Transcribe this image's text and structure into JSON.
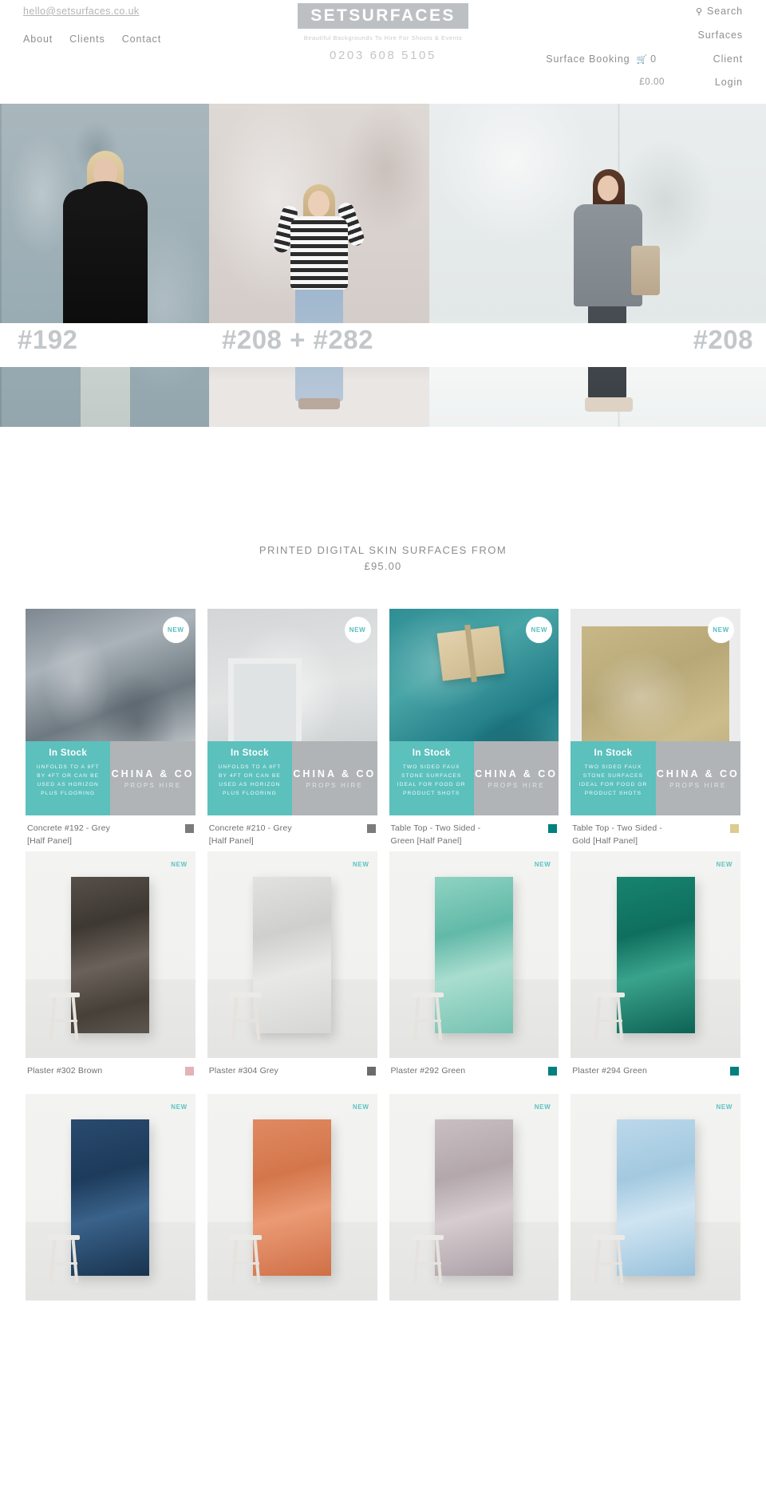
{
  "header": {
    "email": "hello@setsurfaces.co.uk",
    "nav_left": [
      {
        "label": "About"
      },
      {
        "label": "Clients"
      },
      {
        "label": "Contact"
      }
    ],
    "logo": {
      "brand": "SETSURFACES",
      "tagline": "Beautiful Backgrounds To Hire For Shoots & Events",
      "phone": "0203 608 5105",
      "box_color": "#bcc0c2"
    },
    "nav_right": {
      "search_label": "Search",
      "search_icon": "search-icon",
      "surfaces_label": "Surfaces",
      "booking_label": "Surface Booking",
      "cart_icon": "shopping-cart-icon",
      "cart_count": "0",
      "client_label": "Client",
      "cart_total": "£0.00",
      "login_label": "Login"
    }
  },
  "hero": {
    "captions": [
      {
        "text": "#192"
      },
      {
        "text": "#208 + #282"
      },
      {
        "text": "#208"
      }
    ]
  },
  "section": {
    "title": "PRINTED DIGITAL SKIN SURFACES FROM",
    "amount": "£95.00"
  },
  "overlay_defaults": {
    "stock_label": "In Stock",
    "brand_line1": "CHINA & CO",
    "brand_line2": "PROPS HIRE",
    "new_badge": "NEW",
    "teal": "#5cc0bd",
    "grey": "#b0b4b6"
  },
  "products": [
    {
      "name": "Concrete #192 - Grey [Half Panel]",
      "swatch": "#7b7b7b",
      "badge": "NEW",
      "badge_style": "circle",
      "overlay": true,
      "stock_label": "In Stock",
      "overlay_desc": "UNFOLDS TO A 8FT BY 4FT OR CAN BE USED AS HORIZON PLUS FLOORING",
      "brand_line1": "CHINA & CO",
      "brand_line2": "PROPS HIRE",
      "art": "a-concrete192"
    },
    {
      "name": "Concrete #210 - Grey [Half Panel]",
      "swatch": "#7b7b7b",
      "badge": "NEW",
      "badge_style": "circle",
      "overlay": true,
      "stock_label": "In Stock",
      "overlay_desc": "UNFOLDS TO A 8FT BY 4FT OR CAN BE USED AS HORIZON PLUS FLOORING",
      "brand_line1": "CHINA & CO",
      "brand_line2": "PROPS HIRE",
      "art": "a-concrete210"
    },
    {
      "name": "Table Top - Two Sided - Green [Half Panel]",
      "swatch": "#00807e",
      "badge": "NEW",
      "badge_style": "circle",
      "overlay": true,
      "stock_label": "In Stock",
      "overlay_desc": "TWO SIDED FAUX STONE SURFACES IDEAL FOR FOOD OR PRODUCT SHOTS",
      "brand_line1": "CHINA & CO",
      "brand_line2": "PROPS HIRE",
      "art": "a-green"
    },
    {
      "name": "Table Top - Two Sided - Gold [Half Panel]",
      "swatch": "#ddcb8f",
      "badge": "NEW",
      "badge_style": "circle",
      "overlay": true,
      "stock_label": "In Stock",
      "overlay_desc": "TWO SIDED FAUX STONE SURFACES IDEAL FOR FOOD OR PRODUCT SHOTS",
      "brand_line1": "CHINA & CO",
      "brand_line2": "PROPS HIRE",
      "art": "a-gold"
    },
    {
      "name": "Plaster #302 Brown",
      "swatch": "#e4b3b6",
      "badge": "NEW",
      "badge_style": "flat",
      "overlay": false,
      "art": "b-302"
    },
    {
      "name": "Plaster #304 Grey",
      "swatch": "#6b6b6b",
      "badge": "NEW",
      "badge_style": "flat",
      "overlay": false,
      "art": "b-304"
    },
    {
      "name": "Plaster #292 Green",
      "swatch": "#00807e",
      "badge": "NEW",
      "badge_style": "flat",
      "overlay": false,
      "art": "b-292"
    },
    {
      "name": "Plaster #294 Green",
      "swatch": "#00807e",
      "badge": "NEW",
      "badge_style": "flat",
      "overlay": false,
      "art": "b-294"
    },
    {
      "name": "",
      "swatch": "",
      "badge": "NEW",
      "badge_style": "flat",
      "overlay": false,
      "art": "b-blue2"
    },
    {
      "name": "",
      "swatch": "",
      "badge": "NEW",
      "badge_style": "flat",
      "overlay": false,
      "art": "b-orange"
    },
    {
      "name": "",
      "swatch": "",
      "badge": "NEW",
      "badge_style": "flat",
      "overlay": false,
      "art": "b-mauve"
    },
    {
      "name": "",
      "swatch": "",
      "badge": "NEW",
      "badge_style": "flat",
      "overlay": false,
      "art": "b-lightblue"
    }
  ]
}
